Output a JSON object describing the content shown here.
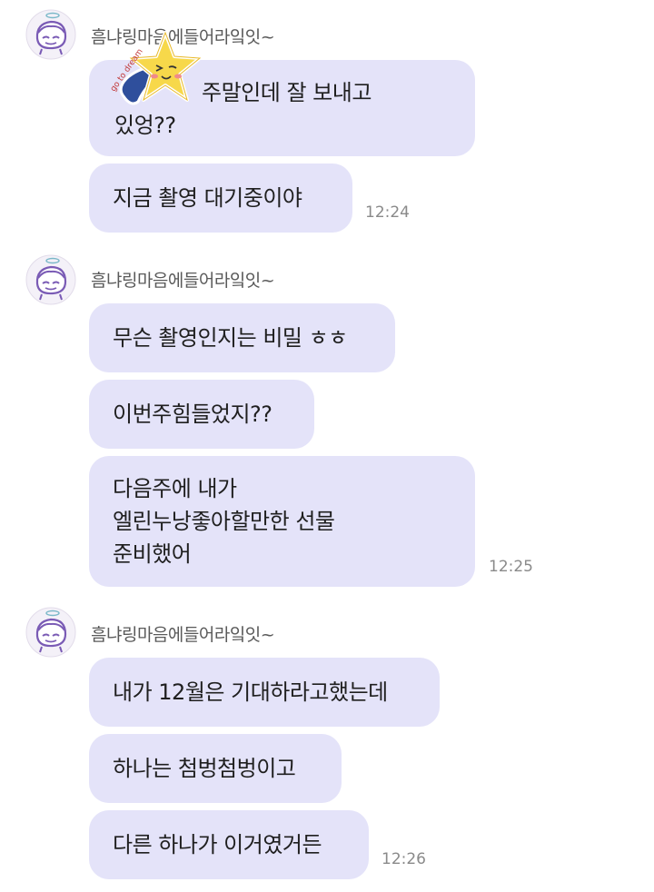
{
  "sender": {
    "name": "흠냐링마음에들어라잌잇~"
  },
  "groups": [
    {
      "messages": [
        {
          "lines": [
            "주말인데 잘 보내고",
            "있엉??"
          ]
        },
        {
          "text": "지금  촬영 대기중이야",
          "time": "12:24"
        }
      ]
    },
    {
      "messages": [
        {
          "text": "무슨 촬영인지는 비밀 ㅎㅎ"
        },
        {
          "text": "이번주힘들었지??"
        },
        {
          "lines": [
            "다음주에 내가",
            "엘린누낭좋아할만한 선물",
            "준비했어"
          ],
          "time": "12:25"
        }
      ]
    },
    {
      "messages": [
        {
          "text": "내가 12월은 기대하라고했는데"
        },
        {
          "text": "하나는 첨벙첨벙이고"
        },
        {
          "text": "다른 하나가 이거였거든",
          "time": "12:26"
        }
      ]
    }
  ],
  "sticker": {
    "icon": "shooting-star-sticker-icon",
    "text": "go to dream"
  },
  "colors": {
    "bubble": "#e4e3f9",
    "avatar_ring": "#ffffff",
    "avatar_accent": "#7a5bb5"
  }
}
